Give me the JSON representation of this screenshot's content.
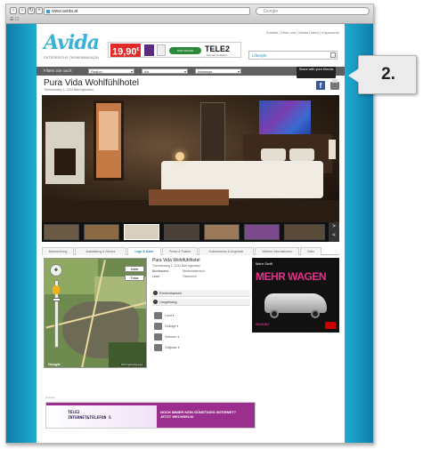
{
  "browser": {
    "url": "www.avida.at",
    "search_placeholder": "Google",
    "bookmarks": "☰ ☐"
  },
  "header": {
    "logo": "Avida",
    "tagline": "ÖSTERREICHS THEMENMAGAZIN",
    "toplinks": "Kontakt  |  Über uns  |  Media Daten  |  Impressum",
    "search_value": "Lifestyle",
    "banner": {
      "price": "19,90",
      "price_cents": "€",
      "green_label": "NUR ONLINE",
      "brand": "TELE2",
      "brand_sub": "internet & telefon"
    }
  },
  "filter": {
    "label": "Filtern Sie nach:",
    "dropdowns": [
      "Region",
      "Art",
      "Interesse"
    ],
    "share_label": "Share with your friends"
  },
  "hotel": {
    "name": "Pura Vida Wohlfühlhotel",
    "subtitle": "Thermenweg 1, 1234 Bad Irgendwo"
  },
  "thumb_nav": {
    "next": ">",
    "prev": "<"
  },
  "tabs": [
    {
      "label": "Beschreibung",
      "active": false
    },
    {
      "label": "Ausstattung & Service",
      "active": false
    },
    {
      "label": "Lage & Karte",
      "active": true
    },
    {
      "label": "Preise & Pakete",
      "active": false
    },
    {
      "label": "Kulinarisches & Angebote",
      "active": false
    },
    {
      "label": "Weitere Informationen",
      "active": false
    },
    {
      "label": "Video",
      "active": false
    }
  ],
  "map": {
    "type_map": "Karte",
    "type_sat": "Fotos",
    "provider": "Google",
    "legal": "Nutzungsbedingungen",
    "pan_icon": "✥"
  },
  "info": {
    "name": "Pura Vida Wohlfühlhotel",
    "address": "Thermenweg 1, 1234 Bad Irgendwo",
    "rows": [
      {
        "k": "Bundesland:",
        "v": "Niederösterreich"
      },
      {
        "k": "Land:",
        "v": "Österreich"
      }
    ],
    "sections": [
      "Erreichbarkeit",
      "Umgebung"
    ],
    "pois": [
      "Lund ▾",
      "Geänge ▾",
      "Sehenw. ▾",
      "Golfplatz ▾"
    ]
  },
  "ad_box": {
    "small": "Mehr Swift",
    "headline": "MEHR WAGEN",
    "brand": "SUZUKI"
  },
  "footer_ad": {
    "label": "Anzeige",
    "left": "TELE2\nINTERNET&TELEFON S",
    "right": "NOCH IMMER KEIN GÜNSTIGES INTERNET?\nJETZT WECHSELN!"
  },
  "callout": {
    "number": "2."
  }
}
